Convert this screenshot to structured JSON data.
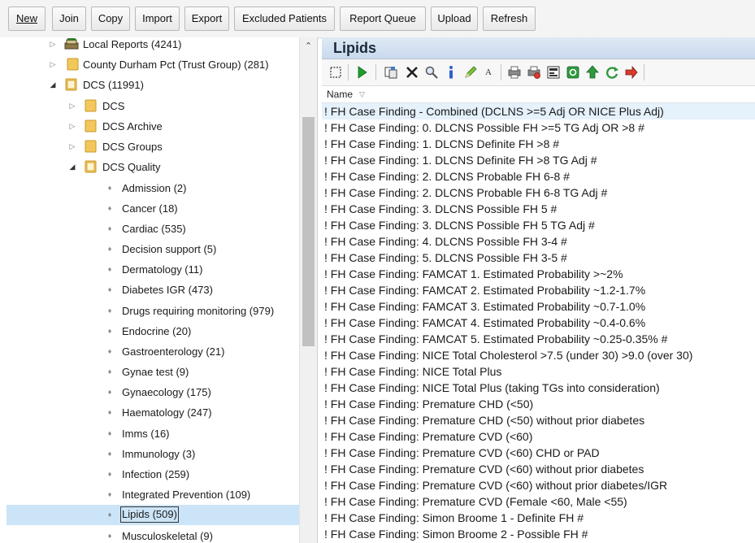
{
  "toolbar": {
    "buttons": [
      "New",
      "Join",
      "Copy",
      "Import",
      "Export",
      "Excluded Patients",
      "Report Queue",
      "Upload",
      "Refresh"
    ]
  },
  "tree": {
    "items": [
      {
        "label": "Local Reports (4241)",
        "selected": false
      },
      {
        "label": "County Durham Pct (Trust Group) (281)",
        "selected": false
      },
      {
        "label": "DCS (11991)",
        "selected": false
      },
      {
        "label": "DCS",
        "selected": false
      },
      {
        "label": "DCS Archive",
        "selected": false
      },
      {
        "label": "DCS Groups",
        "selected": false
      },
      {
        "label": "DCS Quality",
        "selected": false
      },
      {
        "label": "Admission (2)",
        "selected": false
      },
      {
        "label": "Cancer (18)",
        "selected": false
      },
      {
        "label": "Cardiac (535)",
        "selected": false
      },
      {
        "label": "Decision support (5)",
        "selected": false
      },
      {
        "label": "Dermatology (11)",
        "selected": false
      },
      {
        "label": "Diabetes IGR (473)",
        "selected": false
      },
      {
        "label": "Drugs requiring monitoring (979)",
        "selected": false
      },
      {
        "label": "Endocrine (20)",
        "selected": false
      },
      {
        "label": "Gastroenterology (21)",
        "selected": false
      },
      {
        "label": "Gynae test (9)",
        "selected": false
      },
      {
        "label": "Gynaecology (175)",
        "selected": false
      },
      {
        "label": "Haematology (247)",
        "selected": false
      },
      {
        "label": "Imms (16)",
        "selected": false
      },
      {
        "label": "Immunology (3)",
        "selected": false
      },
      {
        "label": "Infection (259)",
        "selected": false
      },
      {
        "label": "Integrated Prevention (109)",
        "selected": false
      },
      {
        "label": "Lipids (509)",
        "selected": true
      },
      {
        "label": "Musculoskeletal (9)",
        "selected": false
      }
    ]
  },
  "panel": {
    "title": "Lipids",
    "column_header": "Name",
    "rows": [
      "! FH Case Finding - Combined (DCLNS >=5 Adj OR NICE Plus Adj)",
      "! FH Case Finding: 0. DLCNS Possible FH >=5 TG Adj OR >8 #",
      "! FH Case Finding: 1. DLCNS Definite FH >8 #",
      "! FH Case Finding: 1. DLCNS Definite FH >8 TG Adj #",
      "! FH Case Finding: 2. DLCNS Probable FH 6-8 #",
      "! FH Case Finding: 2. DLCNS Probable FH 6-8 TG Adj #",
      "! FH Case Finding: 3. DLCNS Possible FH 5 #",
      "! FH Case Finding: 3. DLCNS Possible FH 5 TG Adj #",
      "! FH Case Finding: 4. DLCNS Possible FH 3-4 #",
      "! FH Case Finding: 5. DLCNS Possible FH 3-5 #",
      "! FH Case Finding: FAMCAT 1. Estimated Probability >~2%",
      "! FH Case Finding: FAMCAT 2. Estimated Probability ~1.2-1.7%",
      "! FH Case Finding: FAMCAT 3. Estimated Probability ~0.7-1.0%",
      "! FH Case Finding: FAMCAT 4. Estimated Probability ~0.4-0.6%",
      "! FH Case Finding: FAMCAT 5. Estimated Probability ~0.25-0.35% #",
      "! FH Case Finding: NICE Total Cholesterol >7.5 (under 30) >9.0 (over 30)",
      "! FH Case Finding: NICE Total Plus",
      "! FH Case Finding: NICE Total Plus (taking TGs into consideration)",
      "! FH Case Finding: Premature CHD (<50)",
      "! FH Case Finding: Premature CHD (<50) without prior diabetes",
      "! FH Case Finding: Premature CVD (<60)",
      "! FH Case Finding: Premature CVD (<60) CHD or PAD",
      "! FH Case Finding: Premature CVD (<60) without prior diabetes",
      "! FH Case Finding: Premature CVD (<60) without prior diabetes/IGR",
      "! FH Case Finding: Premature CVD (Female <60, Male <55)",
      "! FH Case Finding: Simon Broome 1 - Definite FH #",
      "! FH Case Finding: Simon Broome 2 - Possible FH #"
    ]
  },
  "colors": {
    "selection": "#cce4f7",
    "row_highlight": "#e5f1fb",
    "header_gradient_top": "#dfe9f5",
    "folder": "#f2c75c",
    "play_green": "#1f9e2e"
  }
}
